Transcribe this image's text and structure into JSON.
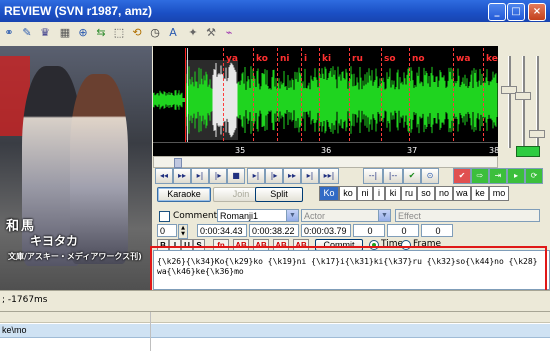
{
  "window": {
    "title": "REVIEW (SVN r1987, amz)"
  },
  "colors": {
    "accent": "#316ac5",
    "highlight": "#e01818",
    "syllable": "#ff3030",
    "waveform": "#1fd41f"
  },
  "video": {
    "subtitle_line1": "和馬",
    "subtitle_line2": "キヨタカ",
    "subtitle_line3": "文庫/アスキー・メディアワークス刊)"
  },
  "audio": {
    "syllables": [
      "ya",
      "ko",
      "ni",
      "i",
      "ki",
      "ru",
      "so",
      "no",
      "wa",
      "ke"
    ],
    "timeline_ticks": [
      "35",
      "36",
      "37",
      "38"
    ]
  },
  "karaoke": {
    "karaoke_label": "Karaoke",
    "join_label": "Join",
    "split_label": "Split",
    "syllables": [
      "Ko",
      "ko",
      "ni",
      "i",
      "ki",
      "ru",
      "so",
      "no",
      "wa",
      "ke",
      "mo"
    ],
    "selected_index": 0
  },
  "edit": {
    "comment_label": "Comment",
    "style": "Romanji1",
    "actor_placeholder": "Actor",
    "effect_placeholder": "Effect",
    "layer": "0",
    "start_time": "0:00:34.43",
    "end_time": "0:00:38.22",
    "duration": "0:00:03.79",
    "margin_l": "0",
    "margin_r": "0",
    "margin_v": "0",
    "commit_label": "Commit",
    "time_label": "Time",
    "frame_label": "Frame",
    "format_buttons": [
      "B",
      "I",
      "U",
      "S",
      "fn",
      "AB",
      "AB",
      "AB",
      "AB"
    ],
    "text": "{\\k26}{\\k34}Ko{\\k29}ko {\\k19}ni {\\k17}i{\\k31}ki{\\k37}ru {\\k32}so{\\k44}no {\\k28}wa{\\k46}ke{\\k36}mo"
  },
  "status": {
    "text": "; -1767ms"
  },
  "grid": {
    "row_text": "ke\\mo"
  }
}
